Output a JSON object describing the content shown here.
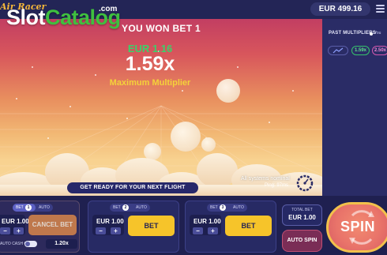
{
  "header": {
    "logo_text": "Air Racer",
    "balance": "EUR 499.16"
  },
  "game": {
    "win_title": "YOU WON BET 1",
    "win_amount": "EUR 1.16",
    "multiplier": "1.59x",
    "multiplier_label": "Maximum Multiplier",
    "next_flight": "GET READY FOR YOUR NEXT FLIGHT",
    "system_status": "All systems nominal",
    "ping": "Ping: 97ms"
  },
  "past_multipliers": {
    "title": "PAST MULTIPLIERS",
    "your_label": "You",
    "values": [
      "1.59x",
      "2.50x"
    ]
  },
  "bets": [
    {
      "number": "1",
      "mode_bet": "BET",
      "mode_auto": "AUTO",
      "stake": "EUR 1.00",
      "action": "CANCEL BET",
      "auto_cash_out_label": "AUTO CASH OUT",
      "auto_cash_out_value": "1.20x"
    },
    {
      "number": "2",
      "mode_bet": "BET",
      "mode_auto": "AUTO",
      "stake": "EUR 1.00",
      "action": "BET"
    },
    {
      "number": "3",
      "mode_bet": "BET",
      "mode_auto": "AUTO",
      "stake": "EUR 1.00",
      "action": "BET"
    }
  ],
  "controls": {
    "total_bet_label": "TOTAL BET",
    "total_bet_value": "EUR 1.00",
    "auto_spin": "AUTO SPIN",
    "spin": "SPIN",
    "minus": "−",
    "plus": "+"
  },
  "watermark": {
    "slot": "Slot",
    "catalog": "Catalog",
    "com": ".com"
  },
  "colors": {
    "bet_button": "#f6c42a",
    "win_amount": "#3ad16a",
    "multiplier_label": "#f4d23a",
    "spin_ring": "#f2c14b"
  }
}
